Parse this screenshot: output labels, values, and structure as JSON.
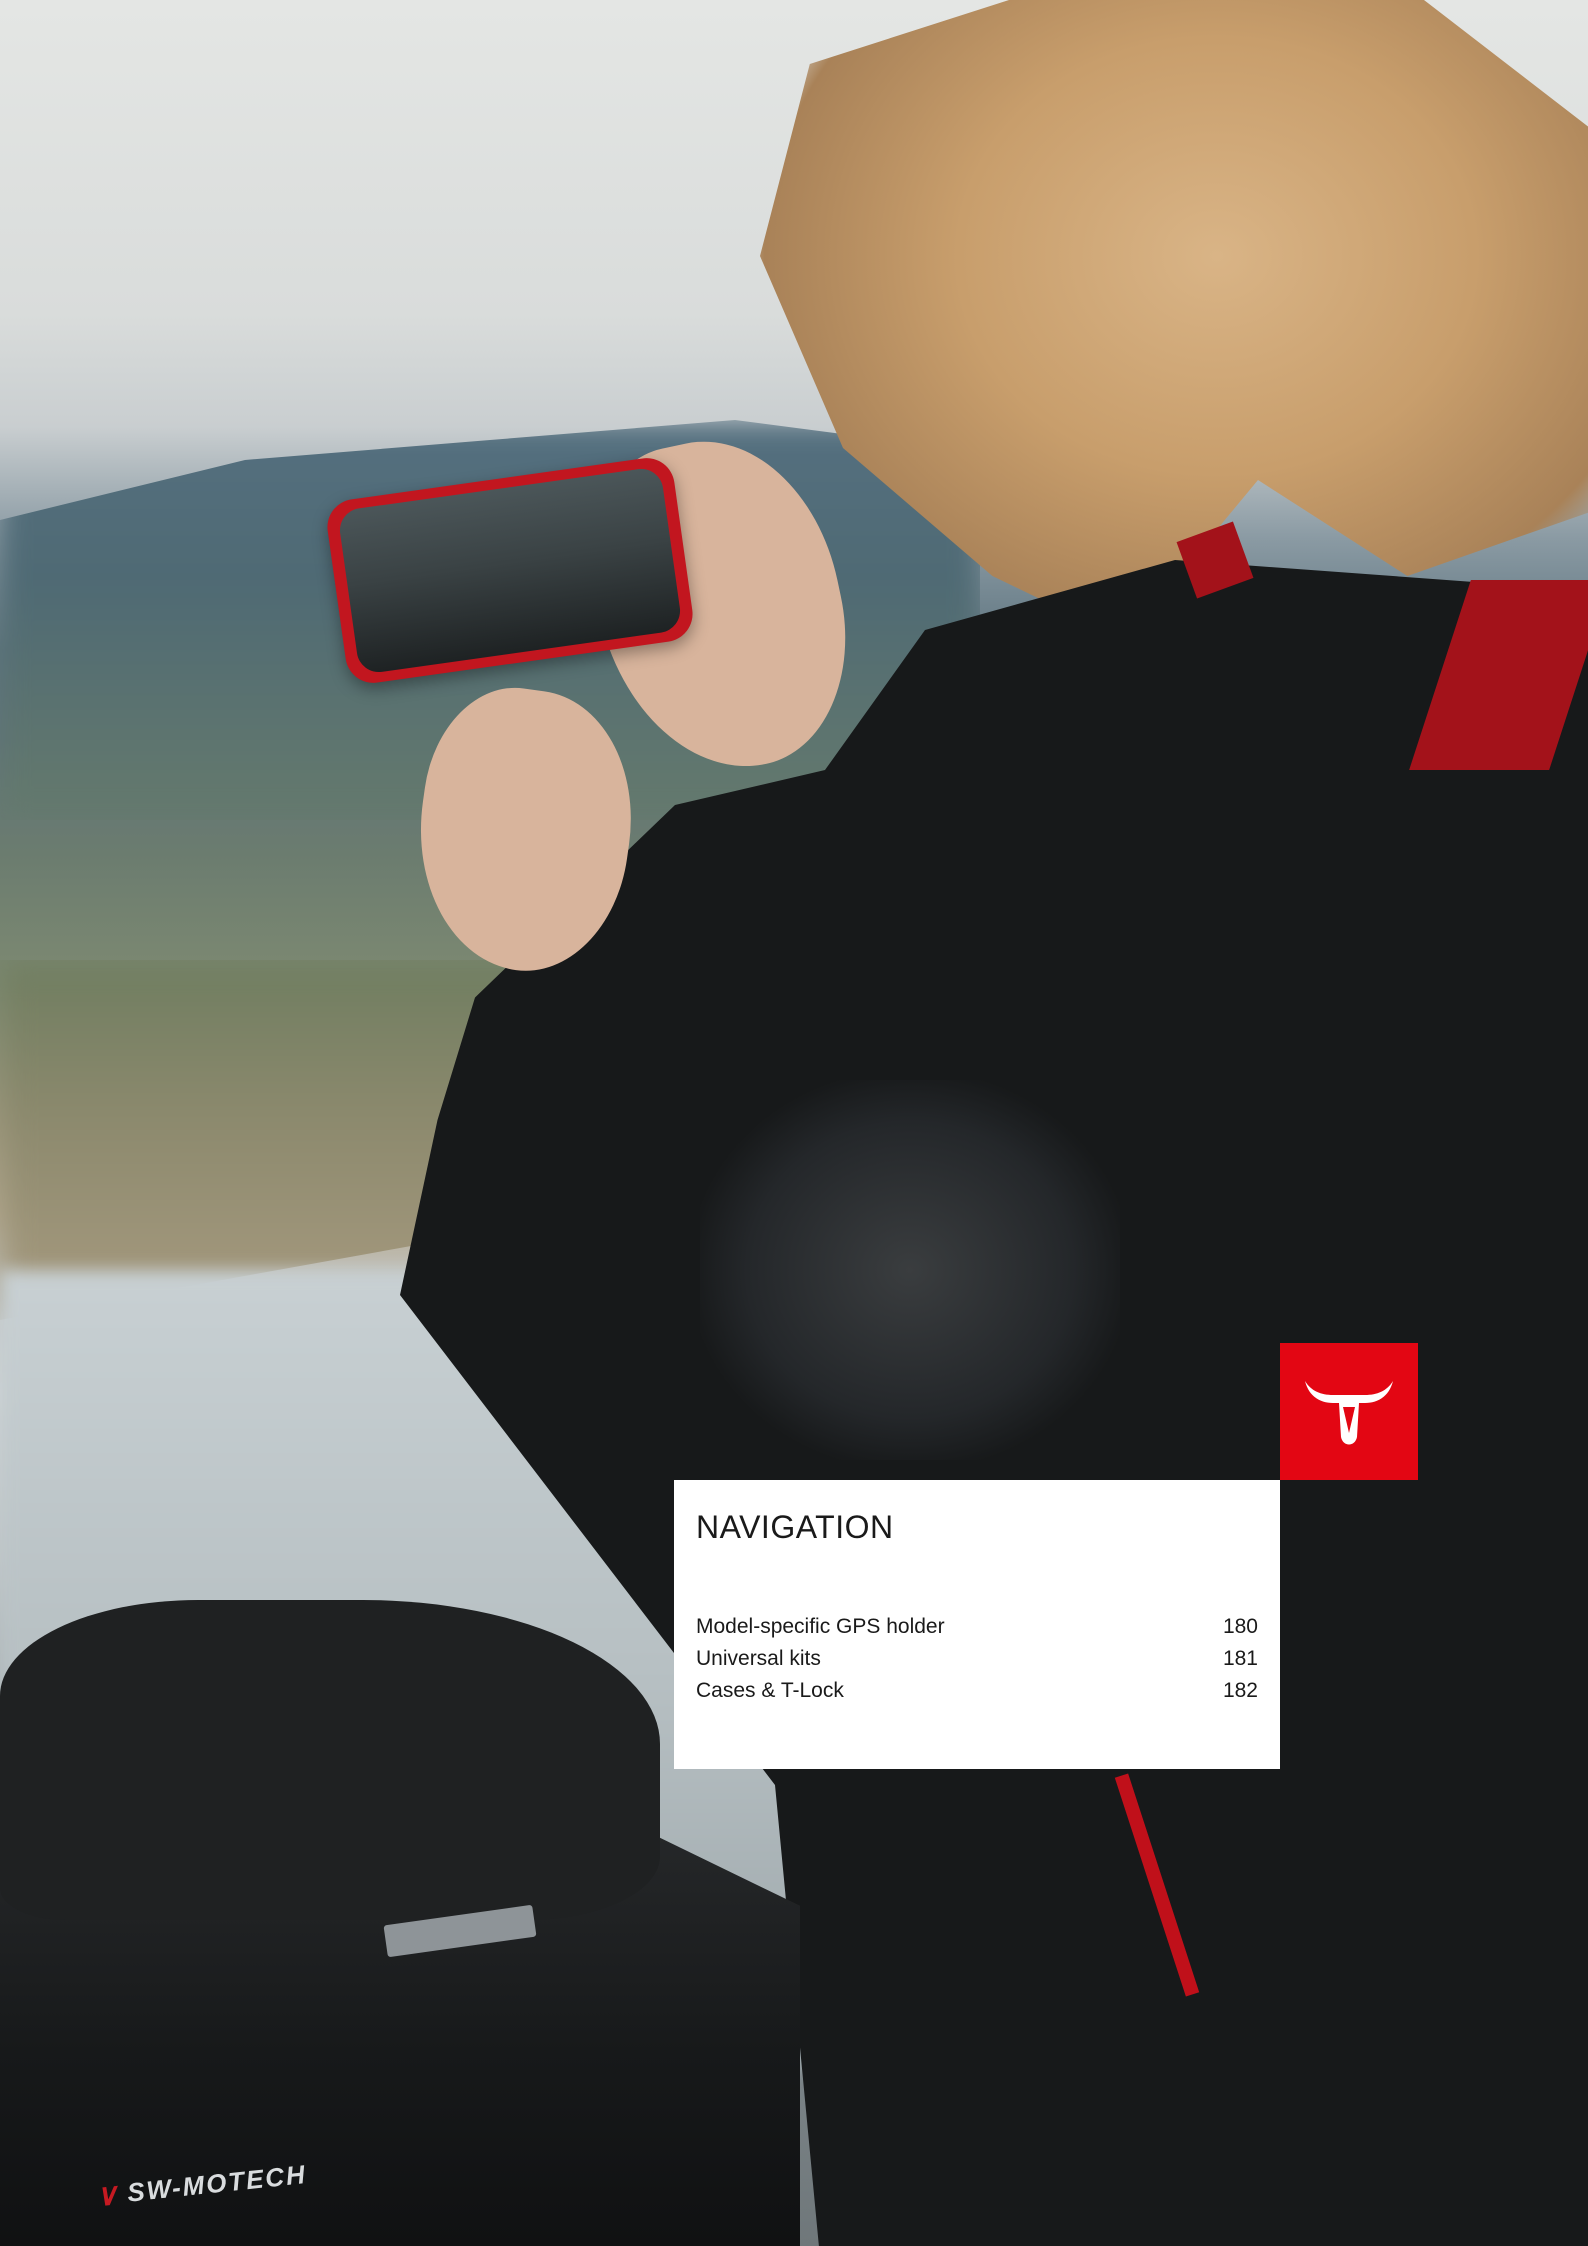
{
  "section": {
    "title": "NAVIGATION",
    "entries": [
      {
        "label": "Model-specific GPS holder",
        "page": "180"
      },
      {
        "label": "Universal kits",
        "page": "181"
      },
      {
        "label": "Cases & T-Lock",
        "page": "182"
      }
    ]
  },
  "brand": {
    "logo_icon": "bull-head-icon",
    "accent_color": "#e30613",
    "bag_logo_text": "SW-MOTECH"
  }
}
